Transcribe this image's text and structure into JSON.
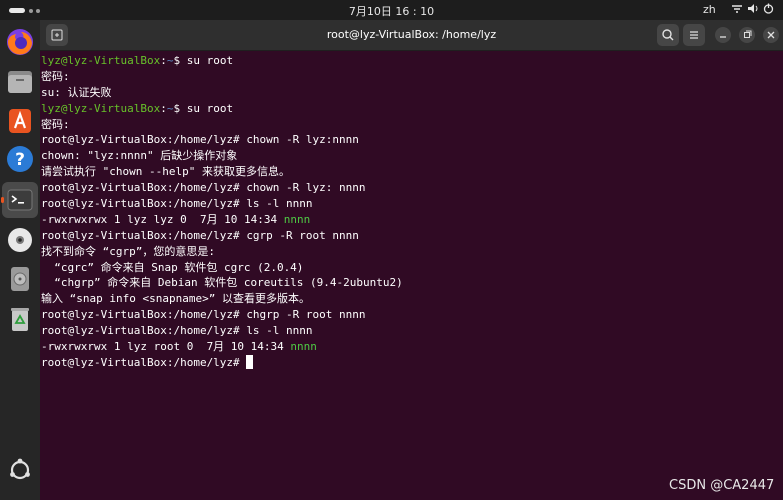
{
  "topbar": {
    "clock": "7月10日 16 : 10",
    "lang": "zh"
  },
  "window": {
    "title": "root@lyz-VirtualBox: /home/lyz"
  },
  "terminal": {
    "user_prompt": "lyz@lyz-VirtualBox",
    "tilde": "~",
    "root_prompt": "root@lyz-VirtualBox:/home/lyz# ",
    "lines": [
      {
        "text": "$ su root"
      },
      {
        "text": "密码:"
      },
      {
        "text": "su: 认证失败"
      },
      {
        "text": "$ su root"
      },
      {
        "text": "密码:"
      },
      {
        "text": "chown -R lyz:nnnn"
      },
      {
        "text": "chown: \"lyz:nnnn\" 后缺少操作对象"
      },
      {
        "text": "请尝试执行 \"chown --help\" 来获取更多信息。"
      },
      {
        "text": "chown -R lyz: nnnn"
      },
      {
        "text": "ls -l nnnn"
      },
      {
        "text": "-rwxrwxrwx 1 lyz lyz 0  7月 10 14:34 "
      },
      {
        "text": "cgrp -R root nnnn"
      },
      {
        "text": "找不到命令 “cgrp”，您的意思是:"
      },
      {
        "text": "  “cgrc” 命令来自 Snap 软件包 cgrc (2.0.4)"
      },
      {
        "text": "  “chgrp” 命令来自 Debian 软件包 coreutils (9.4-2ubuntu2)"
      },
      {
        "text": "输入 “snap info <snapname>” 以查看更多版本。"
      },
      {
        "text": "chgrp -R root nnnn"
      },
      {
        "text": "ls -l nnnn"
      },
      {
        "text": "-rwxrwxrwx 1 lyz root 0  7月 10 14:34 "
      },
      {
        "text": ""
      }
    ],
    "file_name": "nnnn"
  },
  "watermark": "CSDN @CA2447"
}
